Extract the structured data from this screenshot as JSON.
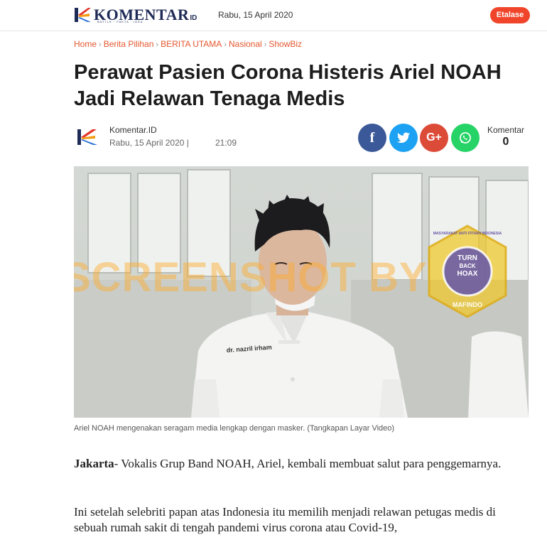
{
  "header": {
    "logo_text": "KOMENTAR",
    "logo_id": "ID",
    "logo_tagline": "BATTLE · FAKTA · IDEA",
    "date": "Rabu, 15 April 2020",
    "etalase_label": "Etalase"
  },
  "breadcrumb": [
    "Home",
    "Berita Pilihan",
    "BERITA UTAMA",
    "Nasional",
    "ShowBiz"
  ],
  "article": {
    "title": "Perawat Pasien Corona Histeris Ariel NOAH Jadi Relawan Tenaga Medis",
    "author": "Komentar.ID",
    "date": "Rabu, 15 April 2020 |",
    "time": "21:09",
    "comment_label": "Komentar",
    "comment_count": "0",
    "image_overlay_text": "SCREENSHOT BY",
    "image_badge_text": "MASYARAKAT ANTI FITNAH INDONESIA",
    "image_badge_bottom": "MAFINDO",
    "image_badge_center": [
      "TURN",
      "BACK",
      "HOAX"
    ],
    "image_nametag": "dr. nazril irham",
    "caption": "Ariel NOAH mengenakan seragam media lengkap dengan masker. (Tangkapan Layar Video)",
    "p1_bold": "Jakarta",
    "p1_rest": "- Vokalis Grup Band NOAH, Ariel, kembali membuat salut para penggemarnya.",
    "p2": "Ini setelah selebriti papan atas Indonesia itu memilih menjadi relawan petugas medis di sebuah rumah sakit di tengah pandemi virus corona atau Covid-19,"
  },
  "share": {
    "facebook_icon": "facebook-icon",
    "twitter_icon": "twitter-icon",
    "gplus_icon": "google-plus-icon",
    "gplus_label": "G+",
    "whatsapp_icon": "whatsapp-icon",
    "facebook_glyph": "f"
  },
  "colors": {
    "accent": "#f0452a",
    "breadcrumb": "#e4572e",
    "facebook": "#3b5998",
    "twitter": "#1da1f2",
    "gplus": "#dc4a38",
    "whatsapp": "#25d366",
    "brand_navy": "#1f2b57"
  }
}
